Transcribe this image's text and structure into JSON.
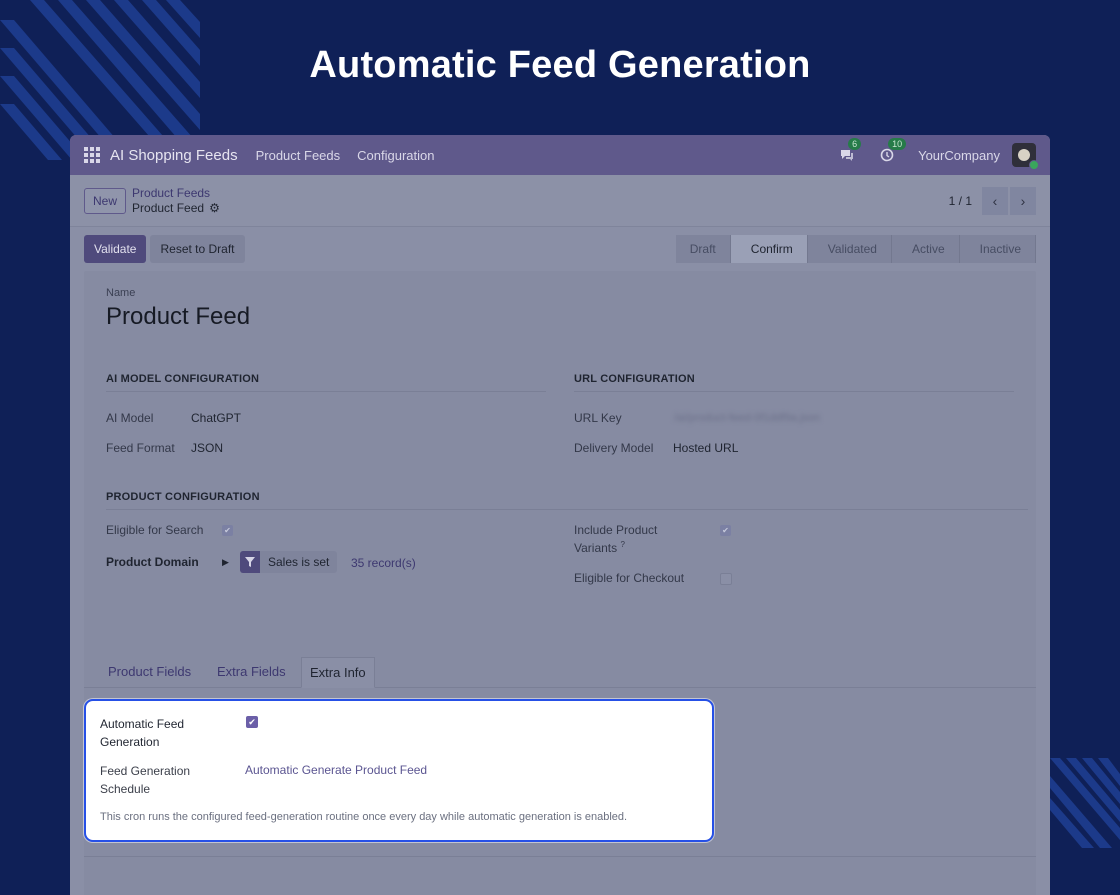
{
  "hero": {
    "title": "Automatic Feed Generation"
  },
  "navbar": {
    "app_name": "AI Shopping Feeds",
    "links": [
      "Product Feeds",
      "Configuration"
    ],
    "messages_count": "6",
    "activities_count": "10",
    "company": "YourCompany"
  },
  "control_panel": {
    "new_label": "New",
    "breadcrumb_parent": "Product Feeds",
    "breadcrumb_current": "Product Feed",
    "pager": "1 / 1"
  },
  "statusbar": {
    "validate_label": "Validate",
    "reset_label": "Reset to Draft",
    "stages": [
      "Draft",
      "Confirm",
      "Validated",
      "Active",
      "Inactive"
    ],
    "active_stage": "Confirm"
  },
  "form": {
    "name_label": "Name",
    "name_value": "Product Feed",
    "ai_section": "AI MODEL CONFIGURATION",
    "ai_model_label": "AI Model",
    "ai_model_value": "ChatGPT",
    "feed_format_label": "Feed Format",
    "feed_format_value": "JSON",
    "url_section": "URL CONFIGURATION",
    "url_key_label": "URL Key",
    "url_key_value": "/ai/product-feed-0f1ddf9a.json",
    "delivery_label": "Delivery Model",
    "delivery_value": "Hosted URL",
    "product_section": "PRODUCT CONFIGURATION",
    "eligible_search_label": "Eligible for Search",
    "eligible_search_checked": true,
    "product_domain_label": "Product Domain",
    "domain_chip": "Sales is set",
    "records": "35 record(s)",
    "include_variants_label_1": "Include Product",
    "include_variants_label_2": "Variants",
    "include_variants_help": "?",
    "include_variants_checked": true,
    "eligible_checkout_label": "Eligible for Checkout",
    "eligible_checkout_checked": false
  },
  "tabs": [
    "Product Fields",
    "Extra Fields",
    "Extra Info"
  ],
  "active_tab": "Extra Info",
  "extra_info": {
    "auto_label_1": "Automatic Feed",
    "auto_label_2": "Generation",
    "auto_checked": true,
    "schedule_label_1": "Feed Generation",
    "schedule_label_2": "Schedule",
    "schedule_value": "Automatic Generate Product Feed",
    "help_text": "This cron runs the configured feed-generation routine once every day while automatic generation is enabled."
  },
  "colors": {
    "background": "#0f2057",
    "navbar": "#5f598b",
    "primary": "#4f4a7c",
    "highlight_border": "#2650e6"
  }
}
